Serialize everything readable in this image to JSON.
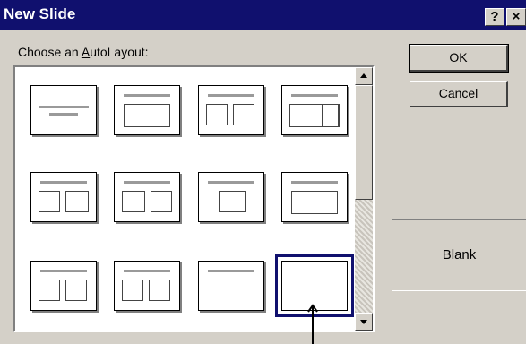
{
  "window": {
    "title": "New Slide",
    "help_label": "?",
    "close_label": "×"
  },
  "layout_label_prefix": "Choose an ",
  "layout_label_accel": "A",
  "layout_label_suffix": "utoLayout:",
  "buttons": {
    "ok": "OK",
    "cancel": "Cancel"
  },
  "preview": {
    "name": "Blank"
  },
  "layouts": [
    "Title Slide",
    "Bulleted List",
    "Two Column Text",
    "Table",
    "Text & Chart",
    "Chart & Text",
    "Organization Chart",
    "Chart",
    "Text & Clip Art",
    "Clip Art & Text",
    "Title Only",
    "Blank"
  ],
  "selected_layout": "Blank",
  "colors": {
    "titlebar": "#10106e",
    "face": "#d4d0c8",
    "selection": "#10106e"
  }
}
